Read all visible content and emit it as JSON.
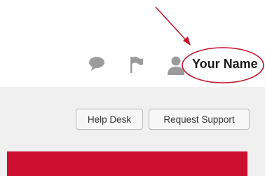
{
  "header": {
    "icons": [
      "chat-bubble-icon",
      "flag-icon",
      "person-icon"
    ],
    "user_name": "Your Name"
  },
  "toolbar": {
    "help_desk_label": "Help Desk",
    "request_support_label": "Request Support"
  },
  "colors": {
    "brand_red": "#cc0f2f",
    "annotation_red": "#c0142c",
    "icon_gray": "#9b9b9b",
    "content_bg": "#f0f0f0"
  }
}
